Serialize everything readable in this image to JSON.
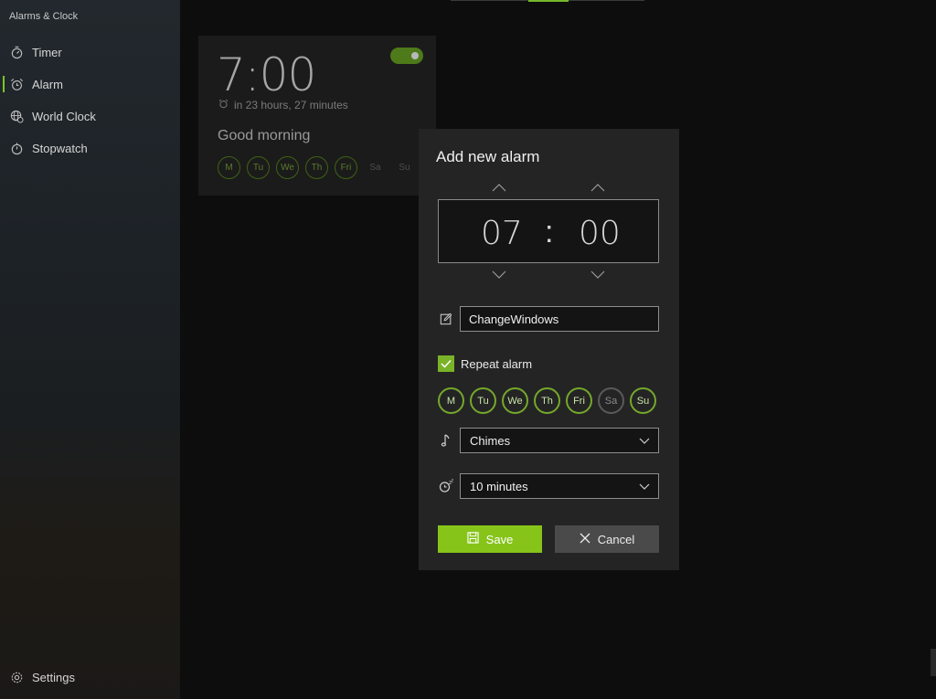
{
  "app": {
    "title": "Alarms & Clock"
  },
  "sidebar": {
    "items": [
      {
        "label": "Timer",
        "icon": "timer-icon",
        "active": false
      },
      {
        "label": "Alarm",
        "icon": "alarm-icon",
        "active": true
      },
      {
        "label": "World Clock",
        "icon": "globe-icon",
        "active": false
      },
      {
        "label": "Stopwatch",
        "icon": "stopwatch-icon",
        "active": false
      }
    ],
    "settings_label": "Settings"
  },
  "alarm_card": {
    "time": "7:00",
    "remaining": "in 23 hours, 27 minutes",
    "name": "Good morning",
    "enabled": true,
    "days": [
      {
        "label": "M",
        "on": true
      },
      {
        "label": "Tu",
        "on": true
      },
      {
        "label": "We",
        "on": true
      },
      {
        "label": "Th",
        "on": true
      },
      {
        "label": "Fri",
        "on": true
      },
      {
        "label": "Sa",
        "on": false
      },
      {
        "label": "Su",
        "on": false
      }
    ]
  },
  "dialog": {
    "title": "Add new alarm",
    "hour": "07",
    "separator": ":",
    "minute": "00",
    "name_value": "ChangeWindows",
    "repeat_label": "Repeat alarm",
    "repeat_checked": true,
    "days": [
      {
        "label": "M",
        "on": true
      },
      {
        "label": "Tu",
        "on": true
      },
      {
        "label": "We",
        "on": true
      },
      {
        "label": "Th",
        "on": true
      },
      {
        "label": "Fri",
        "on": true
      },
      {
        "label": "Sa",
        "on": false
      },
      {
        "label": "Su",
        "on": true
      }
    ],
    "sound_value": "Chimes",
    "snooze_value": "10 minutes",
    "save_label": "Save",
    "cancel_label": "Cancel"
  },
  "colors": {
    "accent": "#86c41a",
    "background": "#0d0d0d",
    "dialog": "#242424"
  }
}
